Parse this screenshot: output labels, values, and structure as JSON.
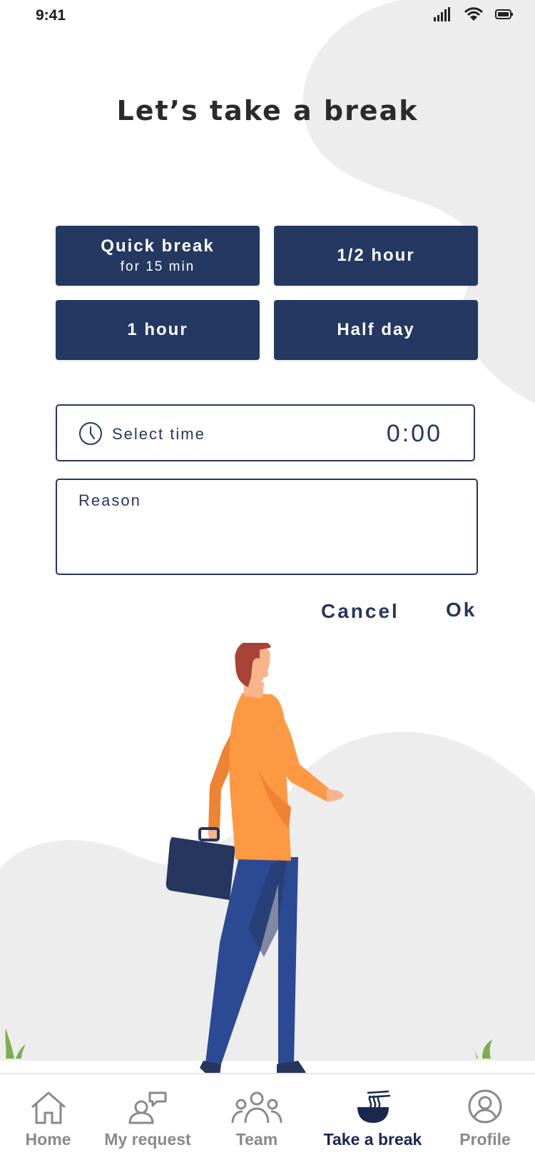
{
  "status": {
    "time": "9:41",
    "icons": [
      "signal-icon",
      "wifi-icon",
      "battery-icon"
    ]
  },
  "title": "Let’s take a break",
  "options": [
    {
      "label": "Quick break",
      "sub": "for 15 min"
    },
    {
      "label": "1/2 hour"
    },
    {
      "label": "1 hour"
    },
    {
      "label": "Half day"
    }
  ],
  "time_field": {
    "label": "Select time",
    "value": "0:00",
    "icon": "clock-icon"
  },
  "reason_field": {
    "placeholder": "Reason"
  },
  "actions": {
    "cancel": "Cancel",
    "ok": "Ok"
  },
  "nav": [
    {
      "label": "Home",
      "icon": "home-icon",
      "active": false
    },
    {
      "label": "My request",
      "icon": "request-icon",
      "active": false
    },
    {
      "label": "Team",
      "icon": "team-icon",
      "active": false
    },
    {
      "label": "Take a break",
      "icon": "noodle-bowl-icon",
      "active": true
    },
    {
      "label": "Profile",
      "icon": "profile-icon",
      "active": false
    }
  ],
  "colors": {
    "primary": "#253862",
    "background_blob": "#ededed",
    "inactive": "#8a8a8a",
    "shirt": "#fd9843",
    "pants": "#2c4a94",
    "hair": "#a84337"
  }
}
